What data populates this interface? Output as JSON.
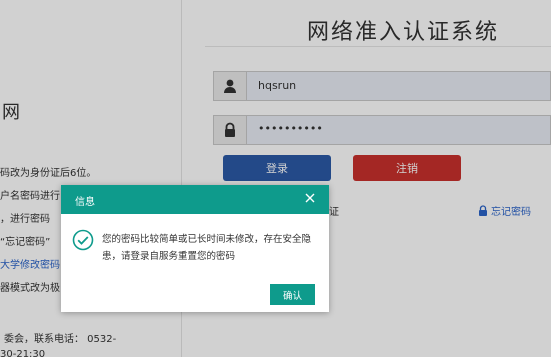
{
  "header": {
    "title": "网络准入认证系统"
  },
  "left_panel": {
    "heading": "网",
    "lines": [
      "码改为身份证后6位。",
      "户名密码进行",
      "，进行密码",
      "“忘记密码”",
      "大学修改密码",
      "器模式改为极",
      "委会，联系电话：  0532-",
      "30-21:30"
    ]
  },
  "login": {
    "username_value": "hqsrun",
    "password_value": "••••••••••",
    "login_label": "登录",
    "cancel_label": "注销",
    "forgot_label": "忘记密码",
    "behind_dialog_text": "证"
  },
  "dialog": {
    "title": "信息",
    "message": "您的密码比较简单或已长时间未修改，存在安全隐患，请登录自服务重置您的密码",
    "ok_label": "确认"
  },
  "colors": {
    "dialog_accent": "#0e9b8c",
    "login_button": "#2b5aa6",
    "cancel_button": "#c9302c",
    "link": "#2a63c9"
  }
}
